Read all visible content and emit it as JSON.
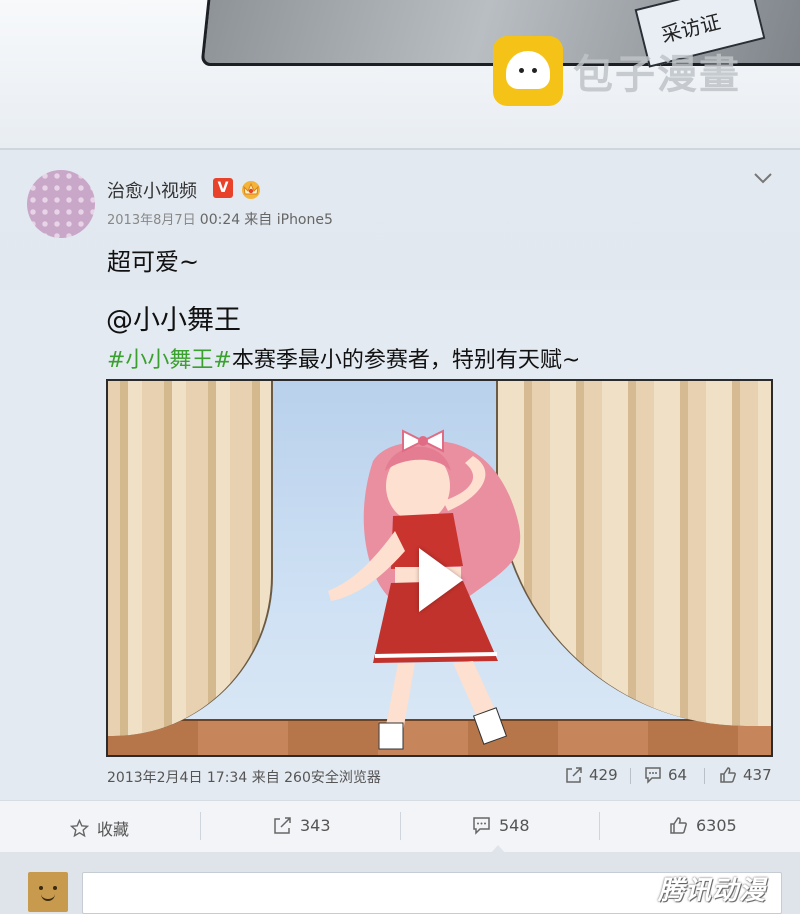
{
  "top_panel": {
    "badge_text": "采访证",
    "watermark_text": "包子漫畫"
  },
  "post": {
    "username": "治愈小视频",
    "verified_badge": "V",
    "date": "2013年8月7日",
    "time": "00:24",
    "source": "来自 iPhone5",
    "text": "超可爱~"
  },
  "quoted": {
    "author": "@小小舞王",
    "hashtag": "#小小舞王#",
    "text": "本赛季最小的参赛者，特别有天赋~",
    "footer": "2013年2月4日 17:34 来自 260安全浏览器",
    "reposts": "429",
    "comments": "64",
    "likes": "437"
  },
  "actions": {
    "favorite_label": "收藏",
    "repost_count": "343",
    "comment_count": "548",
    "like_count": "6305"
  },
  "comment_bar": {
    "watermark_text": "腾讯动漫"
  },
  "icons": {
    "chevron": "chevron-down-icon",
    "star": "star-icon",
    "repost": "repost-icon",
    "comment": "comment-icon",
    "like": "thumbs-up-icon",
    "play": "play-icon",
    "crown": "crown-badge-icon"
  },
  "colors": {
    "hashtag": "#3aa02e",
    "verified": "#e8422b",
    "watermark_logo": "#f5c318"
  }
}
